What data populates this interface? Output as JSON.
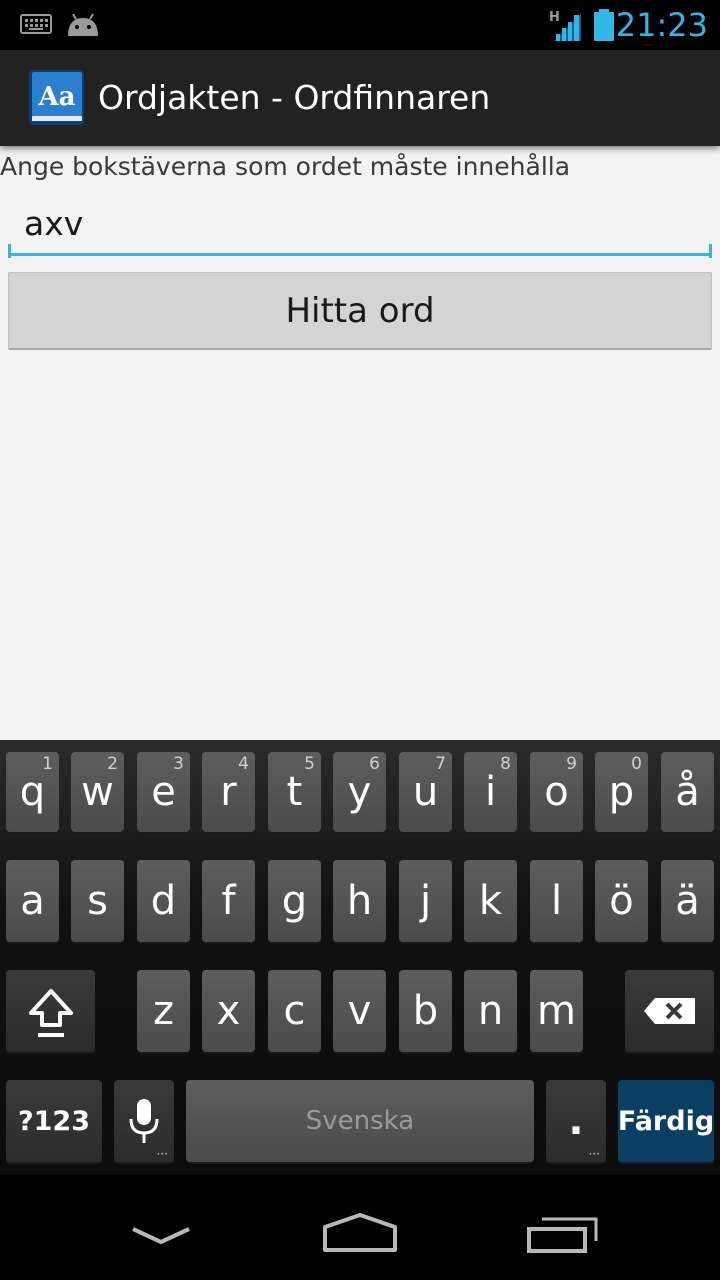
{
  "status_bar": {
    "time": "21:23",
    "network_type": "H",
    "icons": [
      "keyboard-icon",
      "android-debug-icon",
      "signal-icon",
      "battery-icon"
    ],
    "accent_color": "#33b5e5"
  },
  "action_bar": {
    "title": "Ordjakten - Ordfinnaren",
    "app_icon_text": "Aa"
  },
  "form": {
    "prompt": "Ange bokstäverna som ordet måste innehålla",
    "input_value": "axv",
    "button_label": "Hitta ord"
  },
  "keyboard": {
    "row1": [
      {
        "label": "q",
        "hint": "1"
      },
      {
        "label": "w",
        "hint": "2"
      },
      {
        "label": "e",
        "hint": "3"
      },
      {
        "label": "r",
        "hint": "4"
      },
      {
        "label": "t",
        "hint": "5"
      },
      {
        "label": "y",
        "hint": "6"
      },
      {
        "label": "u",
        "hint": "7"
      },
      {
        "label": "i",
        "hint": "8"
      },
      {
        "label": "o",
        "hint": "9"
      },
      {
        "label": "p",
        "hint": "0"
      },
      {
        "label": "å",
        "hint": ""
      }
    ],
    "row2": [
      "a",
      "s",
      "d",
      "f",
      "g",
      "h",
      "j",
      "k",
      "l",
      "ö",
      "ä"
    ],
    "row3": [
      "z",
      "x",
      "c",
      "v",
      "b",
      "n",
      "m"
    ],
    "symbols_label": "?123",
    "space_label": "Svenska",
    "period_label": ".",
    "action_label": "Färdig",
    "action_color": "#0b3e63"
  },
  "nav_bar": {
    "icons": [
      "back-icon",
      "home-icon",
      "recent-apps-icon"
    ]
  }
}
